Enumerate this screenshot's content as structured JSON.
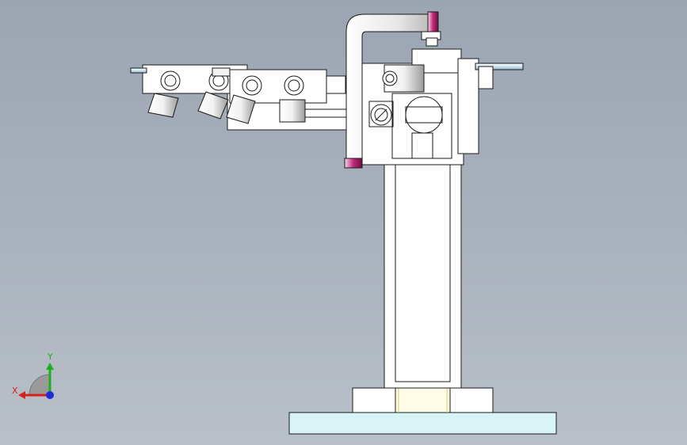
{
  "viewport": {
    "view": "cad-model-front-view",
    "background_top": "#9ba5b2",
    "background_bottom": "#b9c0c9"
  },
  "triad": {
    "x_label": "X",
    "y_label": "Y",
    "x_color": "#d61f1f",
    "y_color": "#19b21b",
    "z_color": "#1f2bd6"
  },
  "model": {
    "part_fill": "#ffffff",
    "edge_color": "#1a1a1a",
    "base_plate_color": "#d9f4f6",
    "handle_accent_color": "#c0287a",
    "rod_color": "#dcecf5",
    "fixture_count": 4
  }
}
